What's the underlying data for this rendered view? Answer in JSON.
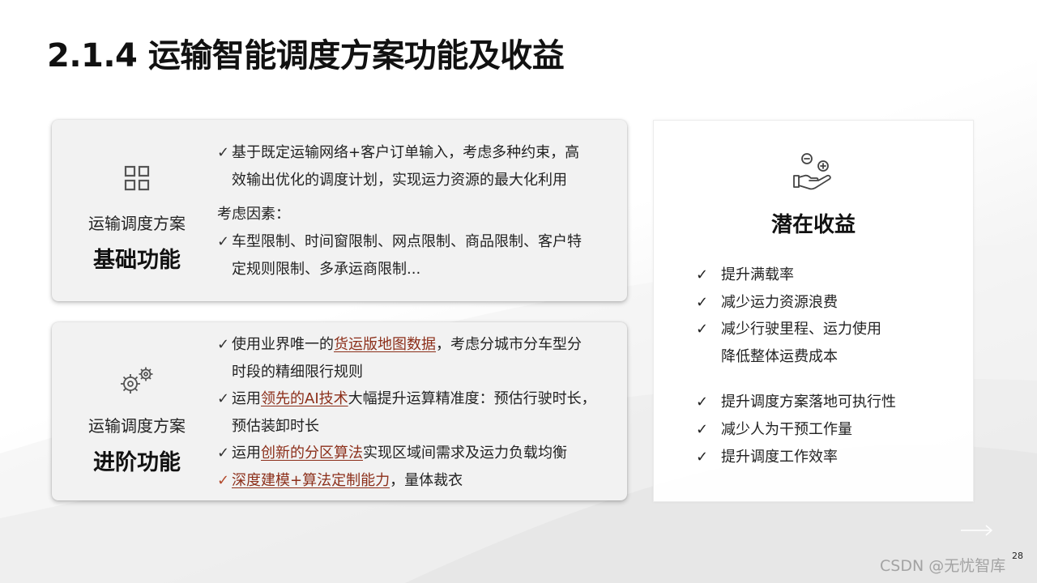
{
  "slide": {
    "title": "2.1.4 运输智能调度方案功能及收益",
    "page_number": "28",
    "watermark": "CSDN @无忧智库"
  },
  "basic_card": {
    "icon": "grid-icon",
    "subtitle": "运输调度方案",
    "heading": "基础功能",
    "bullet1_line1": "基于既定运输网络+客户订单输入，考虑多种约束，高",
    "bullet1_line2": "效输出优化的调度计划，实现运力资源的最大化利用",
    "factors_label": "考虑因素：",
    "bullet2_line1": "车型限制、时间窗限制、网点限制、商品限制、客户特",
    "bullet2_line2": "定规则限制、多承运商限制..."
  },
  "advanced_card": {
    "icon": "gears-icon",
    "subtitle": "运输调度方案",
    "heading": "进阶功能",
    "b1_pre": "使用业界唯一的",
    "b1_hl": "货运版地图数据",
    "b1_post": "，考虑分城市分车型分",
    "b1_line2": "时段的精细限行规则",
    "b2_pre": "运用",
    "b2_hl": "领先的AI技术",
    "b2_post": "大幅提升运算精准度：预估行驶时长，",
    "b2_line2": "预估装卸时长",
    "b3_pre": "运用",
    "b3_hl": "创新的分区算法",
    "b3_post": "实现区域间需求及运力负载均衡",
    "b4_hl": "深度建模+算法定制能力",
    "b4_post": "，量体裁衣"
  },
  "benefits": {
    "icon": "hand-coins-icon",
    "title": "潜在收益",
    "group1": [
      "提升满载率",
      "减少运力资源浪费",
      "减少行驶里程、运力使用",
      "降低整体运费成本"
    ],
    "group2": [
      "提升调度方案落地可执行性",
      "减少人为干预工作量",
      "提升调度工作效率"
    ]
  },
  "colors": {
    "highlight": "#8c2f1a",
    "check_accent": "#b34a2c"
  }
}
